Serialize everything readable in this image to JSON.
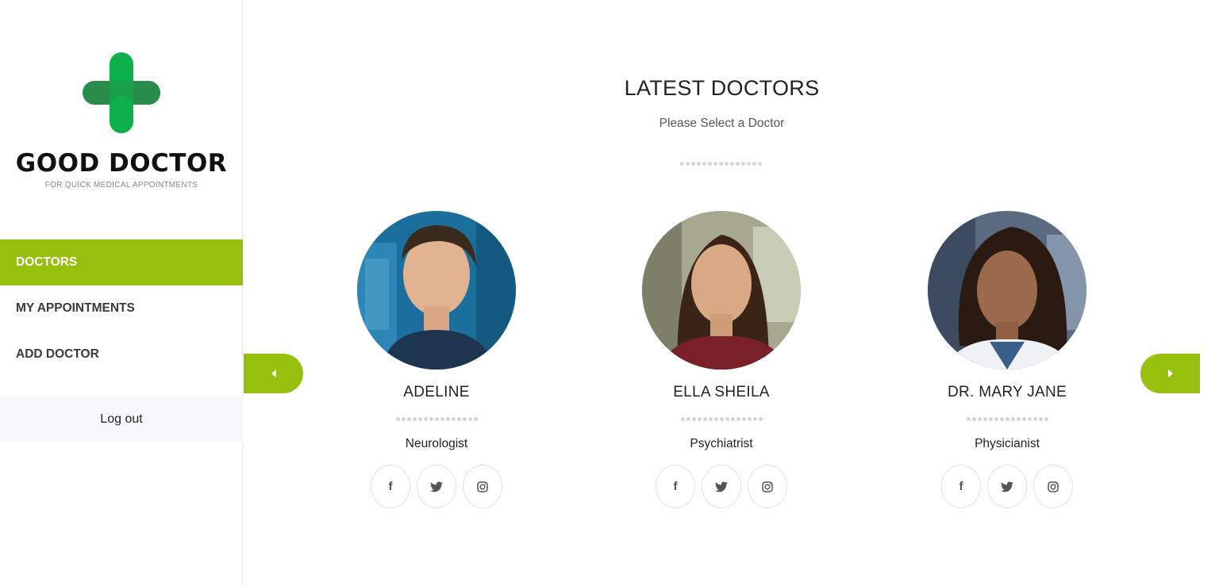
{
  "brand": {
    "name": "GOOD DOCTOR",
    "tagline": "FOR QUICK MEDICAL APPOINTMENTS",
    "colors": {
      "light_green": "#0db14b",
      "dark_green": "#2a8c4a"
    }
  },
  "nav": {
    "items": [
      {
        "label": "DOCTORS",
        "active": true
      },
      {
        "label": "MY APPOINTMENTS",
        "active": false
      },
      {
        "label": "ADD DOCTOR",
        "active": false
      }
    ],
    "logout_label": "Log out"
  },
  "main": {
    "title": "LATEST DOCTORS",
    "subtitle": "Please Select a Doctor",
    "accent_color": "#97bf0d",
    "prev_icon": "caret-left-icon",
    "next_icon": "caret-right-icon"
  },
  "doctors": [
    {
      "name": "ADELINE",
      "specialty": "Neurologist",
      "social_icons": [
        "facebook-icon",
        "twitter-icon",
        "instagram-icon"
      ]
    },
    {
      "name": "ELLA SHEILA",
      "specialty": "Psychiatrist",
      "social_icons": [
        "facebook-icon",
        "twitter-icon",
        "instagram-icon"
      ]
    },
    {
      "name": "DR. MARY JANE",
      "specialty": "Physicianist",
      "social_icons": [
        "facebook-icon",
        "twitter-icon",
        "instagram-icon"
      ]
    }
  ]
}
